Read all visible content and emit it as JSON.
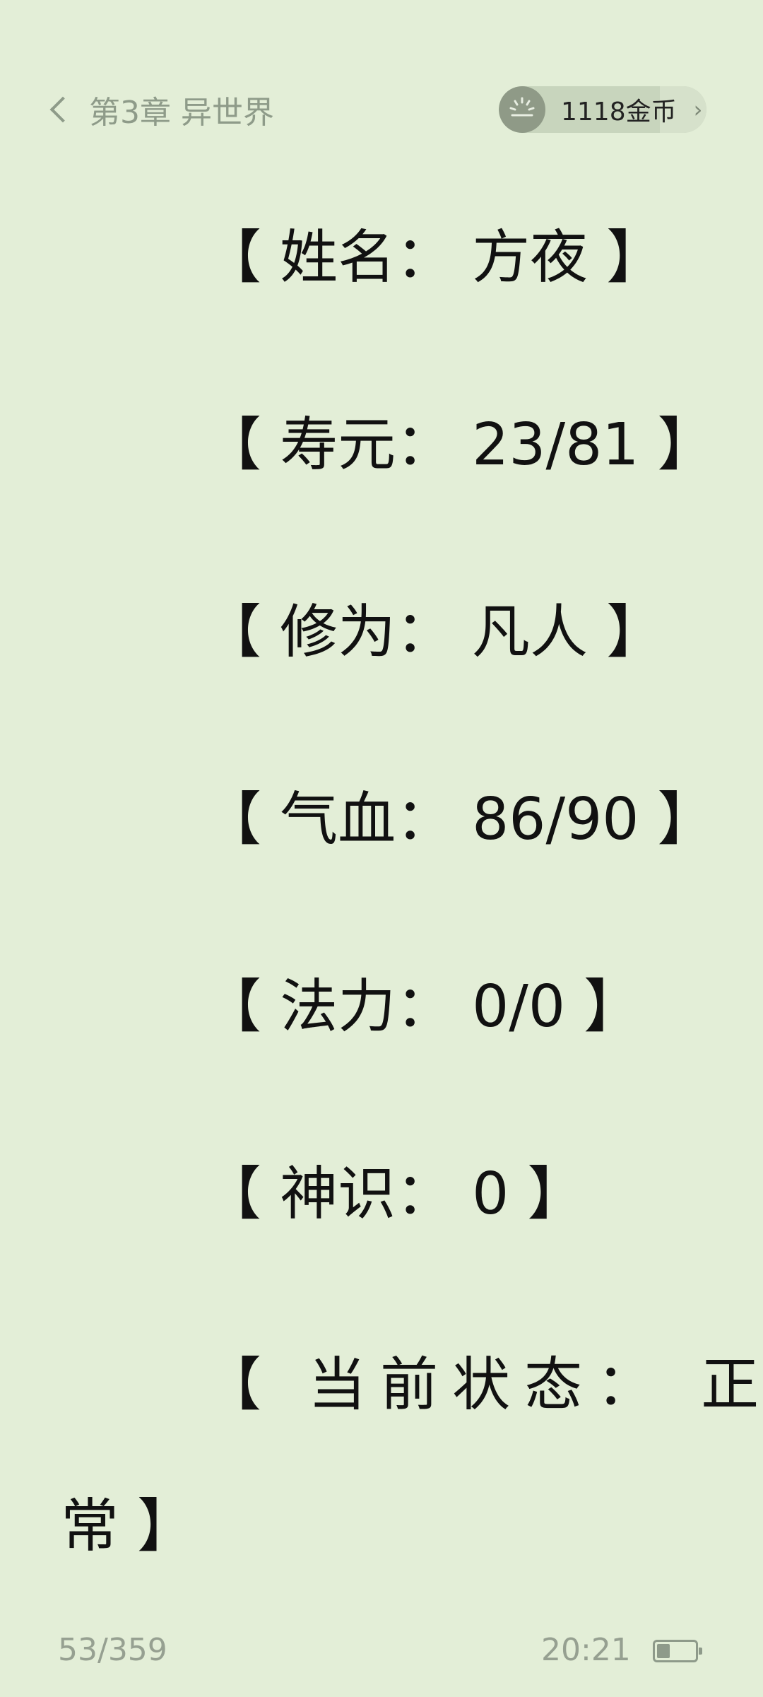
{
  "header": {
    "chapter_title": "第3章 异世界",
    "coins_label": "1118金币",
    "coins_arrow": "›"
  },
  "content": {
    "lines": [
      "【 姓名：  方夜 】",
      "【 寿元：  23/81 】",
      "【 修为：  凡人 】",
      "【 气血：  86/90 】",
      "【 法力：  0/0 】",
      "【 神识：  0 】",
      "【 当前状态： 正",
      "常 】"
    ]
  },
  "footer": {
    "page_indicator": "53/359",
    "time": "20:21",
    "battery_level": 0.35
  }
}
